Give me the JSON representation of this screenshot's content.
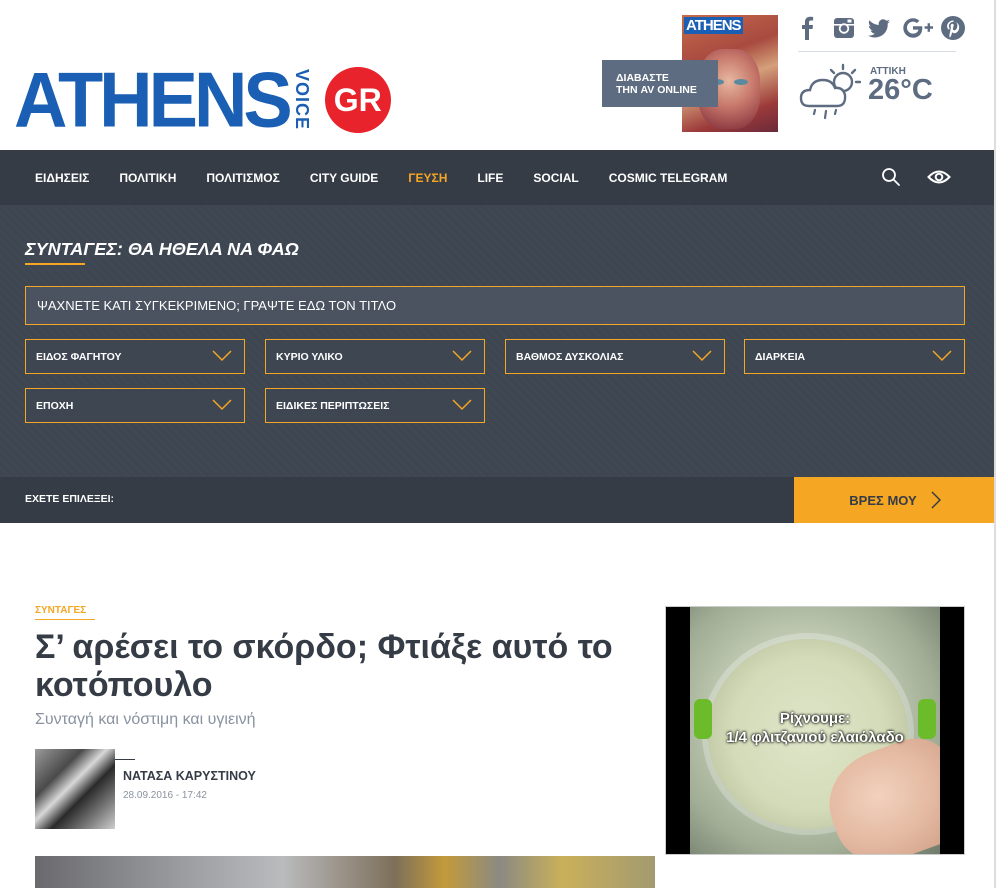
{
  "header": {
    "logo": {
      "main": "ATHENS",
      "vertical": "VOICE",
      "badge": "GR"
    },
    "read_online": {
      "line1": "ΔΙΑΒΑΣΤΕ",
      "line2": "ΤΗΝ AV ONLINE"
    },
    "cover": {
      "title": "ATHENS"
    },
    "social": [
      {
        "name": "facebook-icon",
        "glyph": "f"
      },
      {
        "name": "instagram-icon",
        "glyph": "◘"
      },
      {
        "name": "twitter-icon",
        "glyph": "🐦"
      },
      {
        "name": "googleplus-icon",
        "glyph": "G+"
      },
      {
        "name": "pinterest-icon",
        "glyph": "P"
      }
    ],
    "weather": {
      "region": "ΑΤΤΙΚΗ",
      "temp": "26°C",
      "icon": "cloud-sun-rain-icon"
    }
  },
  "nav": {
    "items": [
      {
        "label": "ΕΙΔΗΣΕΙΣ",
        "active": false
      },
      {
        "label": "ΠΟΛΙΤΙΚΗ",
        "active": false
      },
      {
        "label": "ΠΟΛΙΤΙΣΜΟΣ",
        "active": false
      },
      {
        "label": "CITY GUIDE",
        "active": false
      },
      {
        "label": "ΓΕΥΣΗ",
        "active": true
      },
      {
        "label": "LIFE",
        "active": false
      },
      {
        "label": "SOCIAL",
        "active": false
      },
      {
        "label": "COSMIC TELEGRAM",
        "active": false
      }
    ],
    "accent": "#f5a623",
    "background": "#353c46"
  },
  "recipe_search": {
    "title": "ΣΥΝΤΑΓΕΣ: ΘΑ ΗΘΕΛΑ ΝΑ ΦΑΩ",
    "placeholder": "ΨΑΧΝΕΤΕ ΚΑΤΙ ΣΥΓΚΕΚΡΙΜΕΝΟ; ΓΡΑΨΤΕ ΕΔΩ ΤΟΝ ΤΙΤΛΟ",
    "filters": [
      {
        "label": "ΕΙΔΟΣ ΦΑΓΗΤΟΥ"
      },
      {
        "label": "ΚΥΡΙΟ ΥΛΙΚΟ"
      },
      {
        "label": "ΒΑΘΜΟΣ ΔΥΣΚΟΛΙΑΣ"
      },
      {
        "label": "ΔΙΑΡΚΕΙΑ"
      },
      {
        "label": "ΕΠΟΧΗ"
      },
      {
        "label": "ΕΙΔΙΚΕΣ ΠΕΡΙΠΤΩΣΕΙΣ"
      }
    ],
    "selected_label": "ΕΧΕΤΕ ΕΠΙΛΕΞΕΙ:",
    "find_button": "ΒΡΕΣ ΜΟΥ"
  },
  "article": {
    "category": "ΣΥΝΤΑΓΕΣ",
    "title": "Σ’ αρέσει το σκόρδο; Φτιάξε αυτό το κοτόπουλο",
    "subtitle": "Συνταγή και νόστιμη και υγιεινή",
    "author": "ΝΑΤΑΣΑ ΚΑΡΥΣΤΙΝΟΥ",
    "date": "28.09.2016 - 17:42"
  },
  "video": {
    "caption_line1": "Ρίχνουμε:",
    "caption_line2": "1/4 φλιτζανιού ελαιόλαδο"
  }
}
